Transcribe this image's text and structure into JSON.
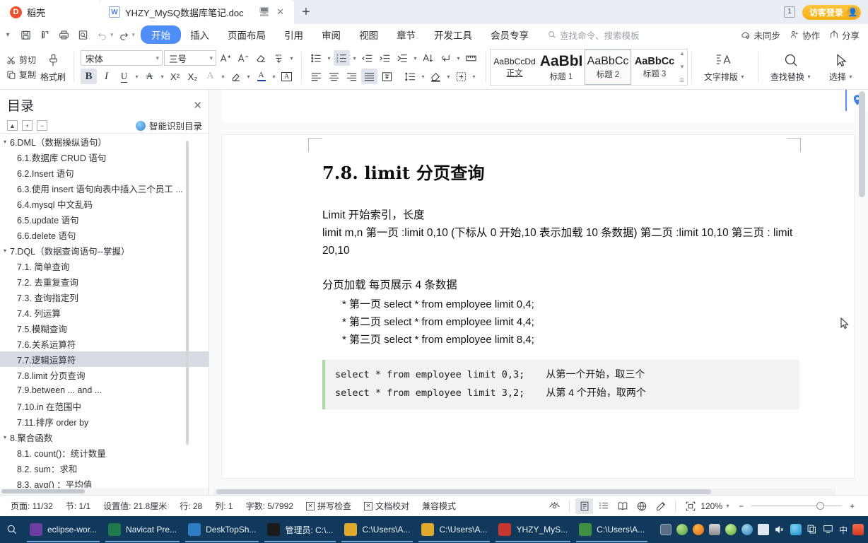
{
  "tabbar": {
    "home_tab": "稻壳",
    "doc_tab": "YHZY_MySQ数据库笔记.doc",
    "new_tab_label": "+",
    "window_count": "1",
    "guest_login": "访客登录",
    "restore_icon": "restore-window-icon",
    "close_icon": "close-tab-icon"
  },
  "menubar": {
    "quick_access": [
      "save-icon",
      "save-as-icon",
      "print-icon",
      "print-preview-icon",
      "undo-icon",
      "redo-icon",
      "customize-icon"
    ],
    "items": [
      {
        "label": "开始",
        "active": true
      },
      {
        "label": "插入",
        "active": false
      },
      {
        "label": "页面布局",
        "active": false
      },
      {
        "label": "引用",
        "active": false
      },
      {
        "label": "审阅",
        "active": false
      },
      {
        "label": "视图",
        "active": false
      },
      {
        "label": "章节",
        "active": false
      },
      {
        "label": "开发工具",
        "active": false
      },
      {
        "label": "会员专享",
        "active": false
      }
    ],
    "search_placeholder": "查找命令、搜索模板",
    "right_items": [
      {
        "label": "未同步",
        "icon": "cloud-sync-icon"
      },
      {
        "label": "协作",
        "icon": "collaborate-icon"
      },
      {
        "label": "分享",
        "icon": "share-icon"
      }
    ]
  },
  "ribbon": {
    "clipboard": {
      "cut": "剪切",
      "copy": "复制",
      "format_painter": "格式刷"
    },
    "font": {
      "family": "宋体",
      "size": "三号",
      "grow_icon": "font-grow-icon",
      "shrink_icon": "font-shrink-icon",
      "clear_format_icon": "clear-format-icon",
      "pinyin_icon": "pinyin-guide-icon",
      "bold": "B",
      "italic": "I",
      "underline": "U",
      "strikethrough_icon": "strikethrough-icon",
      "superscript": "X²",
      "subscript": "X₂",
      "text_effect_icon": "text-effect-icon",
      "highlight_icon": "highlight-icon",
      "font-color_icon": "font-color-icon",
      "char-border_icon": "char-border-icon"
    },
    "paragraph": {
      "bullets_icon": "bullet-list-icon",
      "numbering_icon": "numbered-list-icon",
      "decrease_indent_icon": "decrease-indent-icon",
      "increase_indent_icon": "increase-indent-icon",
      "sort_merge_icon": "merge-paragraph-icon",
      "sort_icon": "sort-icon",
      "show_marks_icon": "show-formatting-marks-icon",
      "ruler_icon": "paragraph-ruler-icon",
      "align_left_icon": "align-left-icon",
      "align_center_icon": "align-center-icon",
      "align_right_icon": "align-right-icon",
      "align_justify_icon": "align-justify-icon",
      "distribute_icon": "distribute-text-icon",
      "line_spacing_icon": "line-spacing-icon",
      "shading_icon": "shading-icon",
      "borders_icon": "borders-icon"
    },
    "styles": [
      {
        "preview": "AaBbCcDd",
        "name": "正文",
        "selected": false
      },
      {
        "preview": "AaBbI",
        "name": "标题 1",
        "selected": false
      },
      {
        "preview": "AaBbCc",
        "name": "标题 2",
        "selected": true
      },
      {
        "preview": "AaBbCc",
        "name": "标题 3",
        "selected": false
      }
    ],
    "typography": {
      "label": "文字排版",
      "icon": "text-typography-icon"
    },
    "find_replace": {
      "label": "查找替换",
      "icon": "search-icon"
    },
    "select": {
      "label": "选择",
      "icon": "cursor-select-icon"
    }
  },
  "sidebar": {
    "title": "目录",
    "close_icon": "close-icon",
    "tools": [
      "collapse-all-icon",
      "expand-level-icon",
      "collapse-level-icon"
    ],
    "smart_toc": "智能识别目录",
    "items": [
      {
        "label": "6.DML（数据操纵语句）",
        "level": 1,
        "expanded": true,
        "selected": false
      },
      {
        "label": "6.1.数据库 CRUD 语句",
        "level": 2,
        "selected": false
      },
      {
        "label": "6.2.Insert 语句",
        "level": 2,
        "selected": false
      },
      {
        "label": "6.3.使用 insert 语句向表中插入三个员工 ...",
        "level": 2,
        "selected": false
      },
      {
        "label": "6.4.mysql 中文乱码",
        "level": 2,
        "selected": false
      },
      {
        "label": "6.5.update 语句",
        "level": 2,
        "selected": false
      },
      {
        "label": "6.6.delete 语句",
        "level": 2,
        "selected": false
      },
      {
        "label": "7.DQL（数据查询语句--掌握）",
        "level": 1,
        "expanded": true,
        "selected": false
      },
      {
        "label": "7.1. 简单查询",
        "level": 2,
        "selected": false
      },
      {
        "label": "7.2. 去重复查询",
        "level": 2,
        "selected": false
      },
      {
        "label": "7.3. 查询指定列",
        "level": 2,
        "selected": false
      },
      {
        "label": "7.4. 列运算",
        "level": 2,
        "selected": false
      },
      {
        "label": "7.5.模糊查询",
        "level": 2,
        "selected": false
      },
      {
        "label": "7.6.关系运算符",
        "level": 2,
        "selected": false
      },
      {
        "label": "7.7.逻辑运算符",
        "level": 2,
        "selected": true
      },
      {
        "label": "7.8.limit 分页查询",
        "level": 2,
        "selected": false
      },
      {
        "label": "7.9.between ... and ...",
        "level": 2,
        "selected": false
      },
      {
        "label": "7.10.in 在范围中",
        "level": 2,
        "selected": false
      },
      {
        "label": "7.11.排序 order by",
        "level": 2,
        "selected": false
      },
      {
        "label": "8.聚合函数",
        "level": 1,
        "expanded": true,
        "selected": false
      },
      {
        "label": "8.1. count()：统计数量",
        "level": 2,
        "selected": false
      },
      {
        "label": "8.2. sum：求和",
        "level": 2,
        "selected": false
      },
      {
        "label": "8.3. avg() ：平均值",
        "level": 2,
        "selected": false
      }
    ]
  },
  "document": {
    "heading": "7.8. limit  分页查询",
    "paragraphs": [
      "Limit  开始索引，长度",
      "limit m,n       第一页 :limit 0,10   (下标从 0 开始,10 表示加载 10 条数据)  第二页 :limit 10,10  第三页 : limit 20,10",
      "分页加载 每页展示 4 条数据"
    ],
    "bullets": [
      "*  第一页  select * from employee limit 0,4;",
      "*  第二页  select * from employee limit 4,4;",
      "*  第三页  select * from employee limit 8,4;"
    ],
    "code": [
      {
        "sql": "select * from employee limit 0,3;",
        "comment": "从第一个开始，取三个"
      },
      {
        "sql": "select * from employee limit 3,2;",
        "comment": "从第 4 个开始，取两个"
      }
    ],
    "pin_icon": "location-pin-icon"
  },
  "statusbar": {
    "page": "页面: 11/32",
    "section": "节: 1/1",
    "setting": "设置值: 21.8厘米",
    "row": "行: 28",
    "col": "列: 1",
    "words": "字数: 5/7992",
    "spellcheck": "拼写检查",
    "proofread": "文档校对",
    "compat_mode": "兼容模式",
    "view_icons": [
      "eye-protect-icon",
      "print-layout-icon",
      "outline-view-icon",
      "reading-view-icon",
      "web-layout-icon",
      "edit-mode-icon"
    ],
    "fit_icon": "fit-page-icon",
    "zoom": "120%",
    "zoom_out": "−",
    "zoom_in": "+"
  },
  "taskbar": {
    "search_icon": "search-icon",
    "apps": [
      {
        "label": "eclipse-wor...",
        "icon": "eclipse-icon",
        "color": "#6a3fa0"
      },
      {
        "label": "Navicat Pre...",
        "icon": "navicat-icon",
        "color": "#1f7a4b"
      },
      {
        "label": "DeskTopSh...",
        "icon": "desktop-share-icon",
        "color": "#2e7cc4"
      },
      {
        "label": "管理员: C:\\...",
        "icon": "cmd-icon",
        "color": "#1b1b1b"
      },
      {
        "label": "C:\\Users\\A...",
        "icon": "folder-icon",
        "color": "#e0a92c"
      },
      {
        "label": "C:\\Users\\A...",
        "icon": "folder-icon",
        "color": "#e0a92c"
      },
      {
        "label": "YHZY_MyS...",
        "icon": "wps-doc-icon",
        "color": "#c8372d"
      },
      {
        "label": "C:\\Users\\A...",
        "icon": "notepad-icon",
        "color": "#3f9142"
      }
    ],
    "tray_icons": [
      "checkbox-tray-icon",
      "earth-icon",
      "key-icon",
      "tools-icon",
      "shield-icon",
      "navicat-tray-icon",
      "battery-icon",
      "volume-mute-icon",
      "sync-icon",
      "copy-icon",
      "display-icon",
      "ime-chinese-icon",
      "sogou-icon"
    ],
    "ime_label": "中"
  },
  "colors": {
    "accent": "#4f8ef7",
    "tabbar_bg": "#e9eef5",
    "taskbar_bg": "#10395b",
    "selection": "#d7dbe2",
    "code_bg": "#f2f2f2",
    "code_bar": "#a9d8a1",
    "login_gold": "#f7ae16"
  }
}
